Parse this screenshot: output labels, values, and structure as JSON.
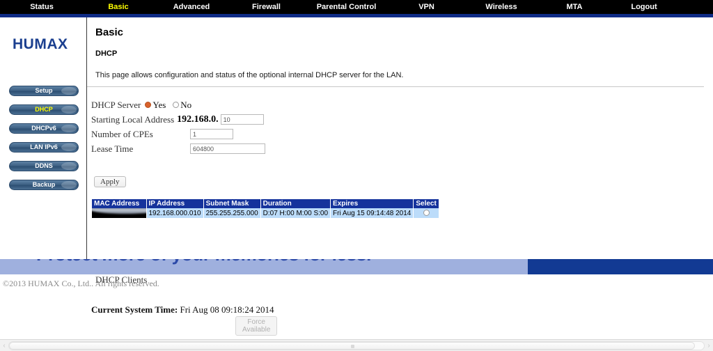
{
  "topnav": {
    "items": [
      {
        "label": "Status",
        "active": false
      },
      {
        "label": "Basic",
        "active": true
      },
      {
        "label": "Advanced",
        "active": false
      },
      {
        "label": "Firewall",
        "active": false
      },
      {
        "label": "Parental Control",
        "active": false
      },
      {
        "label": "VPN",
        "active": false
      },
      {
        "label": "Wireless",
        "active": false
      },
      {
        "label": "MTA",
        "active": false
      },
      {
        "label": "Logout",
        "active": false
      }
    ],
    "active_color": "#ffff00",
    "bar_color": "#000000",
    "underline_color": "#0f2b86"
  },
  "sidebar": {
    "logo": "HUMAX",
    "logo_color": "#1b3f8f",
    "items": [
      {
        "label": "Setup",
        "active": false
      },
      {
        "label": "DHCP",
        "active": true
      },
      {
        "label": "DHCPv6",
        "active": false
      },
      {
        "label": "LAN IPv6",
        "active": false
      },
      {
        "label": "DDNS",
        "active": false
      },
      {
        "label": "Backup",
        "active": false
      }
    ]
  },
  "content": {
    "page_title": "Basic",
    "section_title": "DHCP",
    "intro": "This page allows configuration and status of the optional internal DHCP server for the LAN."
  },
  "form": {
    "dhcp_server": {
      "label": "DHCP Server",
      "yes_label": "Yes",
      "no_label": "No",
      "selected": "Yes"
    },
    "starting_address": {
      "label": "Starting Local Address",
      "prefix": "192.168.0.",
      "value": "10",
      "placeholder": ""
    },
    "number_of_cpes": {
      "label": "Number of CPEs",
      "value": "1",
      "placeholder": ""
    },
    "lease_time": {
      "label": "Lease Time",
      "value": "604800",
      "placeholder": ""
    },
    "apply_label": "Apply"
  },
  "clients": {
    "title": "DHCP Clients",
    "columns": [
      "MAC Address",
      "IP Address",
      "Subnet Mask",
      "Duration",
      "Expires",
      "Select"
    ],
    "rows": [
      {
        "mac_address": "",
        "mac_redacted": true,
        "ip_address": "192.168.000.010",
        "subnet_mask": "255.255.255.000",
        "duration": "D:07 H:00 M:00 S:00",
        "expires": "Fri Aug 15 09:14:48 2014",
        "selected": false
      }
    ],
    "header_bg": "#15339c",
    "row_bg": "#bcdcfa"
  },
  "system_time": {
    "label": "Current System Time:",
    "value": "Fri Aug 08 09:18:24 2014"
  },
  "force_available": {
    "label": "Force Available",
    "disabled": true
  },
  "banner": {
    "text": "Protect more of your memories for less.",
    "bg_color": "#9fb0de",
    "text_color": "#2b49a8",
    "block_color": "#123a93"
  },
  "footer": {
    "copyright": "©2013 HUMAX Co., Ltd.. All rights reserved."
  },
  "scrollbar": {
    "left_arrow": "‹",
    "right_arrow": "›"
  }
}
